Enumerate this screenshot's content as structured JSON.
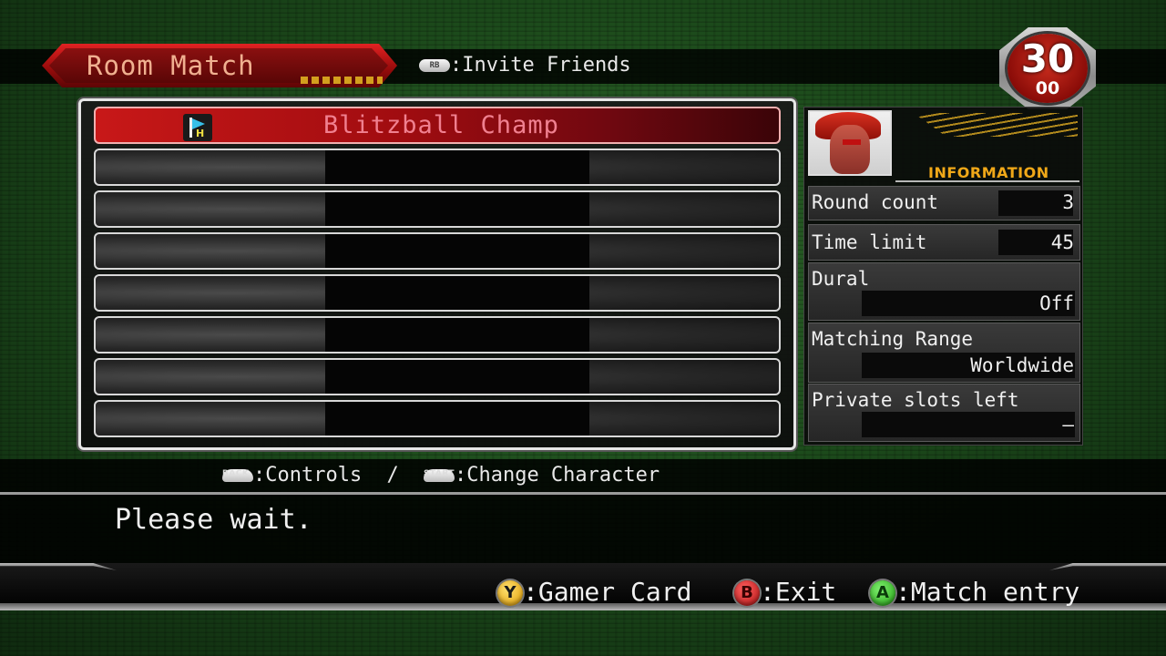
{
  "header": {
    "title": "Room Match",
    "invite_button_icon": "RB",
    "invite_label": ":Invite Friends"
  },
  "timer": {
    "main": "30",
    "sub": "00"
  },
  "room_list": {
    "host_name": "Blitzball Champ",
    "host_badge_letter": "H",
    "empty_slot_count": 7
  },
  "info": {
    "label": "INFORMATION",
    "rows": [
      {
        "label": "Round count",
        "value": "3"
      },
      {
        "label": "Time limit",
        "value": "45"
      },
      {
        "label": "Dural",
        "value": "Off"
      },
      {
        "label": "Matching Range",
        "value": "Worldwide"
      },
      {
        "label": "Private slots left",
        "value": "—"
      }
    ]
  },
  "hints": {
    "back_icon": "BACK",
    "controls_label": ":Controls",
    "separator": "/",
    "start_icon": "START",
    "change_character_label": ":Change Character"
  },
  "message": "Please wait.",
  "actions": {
    "gamer_card": {
      "button": "Y",
      "label": ":Gamer Card"
    },
    "exit": {
      "button": "B",
      "label": ":Exit"
    },
    "match_entry": {
      "button": "A",
      "label": ":Match entry"
    }
  },
  "colors": {
    "accent_red": "#c81818",
    "info_gold": "#f0a818",
    "host_text": "#f08090"
  }
}
